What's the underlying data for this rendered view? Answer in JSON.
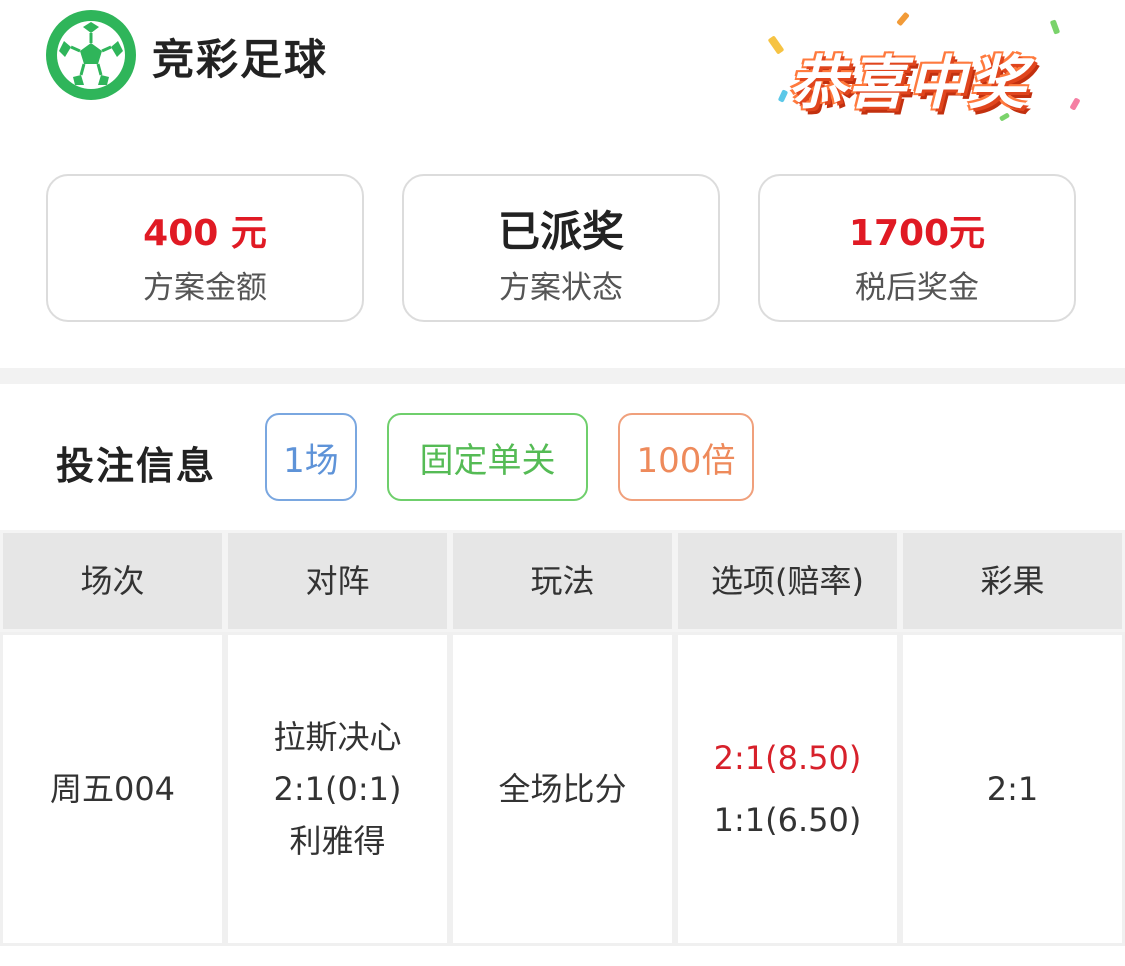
{
  "header": {
    "app_title": "竞彩足球",
    "logo_icon": "soccer-ball-icon",
    "banner_text": "恭喜中奖"
  },
  "summary": {
    "amount_value": "400 元",
    "amount_label": "方案金额",
    "status_value": "已派奖",
    "status_label": "方案状态",
    "prize_value": "1700元",
    "prize_label": "税后奖金"
  },
  "bet_info": {
    "title": "投注信息",
    "tags": [
      "1场",
      "固定单关",
      "100倍"
    ]
  },
  "table": {
    "headers": [
      "场次",
      "对阵",
      "玩法",
      "选项(赔率)",
      "彩果"
    ],
    "rows": [
      {
        "match_no": "周五004",
        "home_team": "拉斯决心",
        "score": "2:1(0:1)",
        "away_team": "利雅得",
        "play_type": "全场比分",
        "options": [
          "2:1(8.50)",
          "1:1(6.50)"
        ],
        "result": "2:1"
      }
    ]
  },
  "colors": {
    "brand_green": "#2fb55a",
    "red": "#e01a24",
    "tag_blue": "#5e93d8",
    "tag_green": "#55bb55",
    "tag_orange": "#ee8a5b"
  }
}
